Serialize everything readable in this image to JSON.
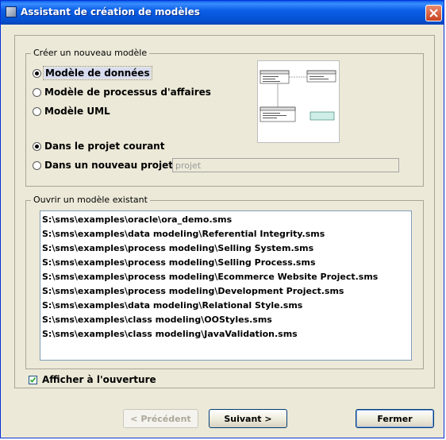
{
  "window": {
    "title": "Assistant de création de modèles"
  },
  "create_group": {
    "title": "Créer un nouveau modèle",
    "model_types": [
      {
        "label": "Modèle de données",
        "selected": true
      },
      {
        "label": "Modèle de processus d'affaires",
        "selected": false
      },
      {
        "label": "Modèle UML",
        "selected": false
      }
    ],
    "locations": [
      {
        "label": "Dans le projet courant",
        "selected": true
      },
      {
        "label": "Dans un nouveau projet:",
        "selected": false
      }
    ],
    "project_field": {
      "value": "projet"
    }
  },
  "open_group": {
    "title": "Ouvrir un modèle existant",
    "files": [
      "S:\\sms\\examples\\oracle\\ora_demo.sms",
      "S:\\sms\\examples\\data modeling\\Referential Integrity.sms",
      "S:\\sms\\examples\\process modeling\\Selling System.sms",
      "S:\\sms\\examples\\process modeling\\Selling Process.sms",
      "S:\\sms\\examples\\process modeling\\Ecommerce Website Project.sms",
      "S:\\sms\\examples\\process modeling\\Development Project.sms",
      "S:\\sms\\examples\\data modeling\\Relational Style.sms",
      "S:\\sms\\examples\\class modeling\\OOStyles.sms",
      "S:\\sms\\examples\\class modeling\\JavaValidation.sms"
    ]
  },
  "show_on_open": {
    "label": "Afficher à l'ouverture",
    "checked": true
  },
  "buttons": {
    "previous": "< Précédent",
    "next": "Suivant >",
    "close": "Fermer"
  },
  "colors": {
    "titlebar": "#0555d9",
    "face": "#ece9d8",
    "list_border": "#7f9db9"
  }
}
